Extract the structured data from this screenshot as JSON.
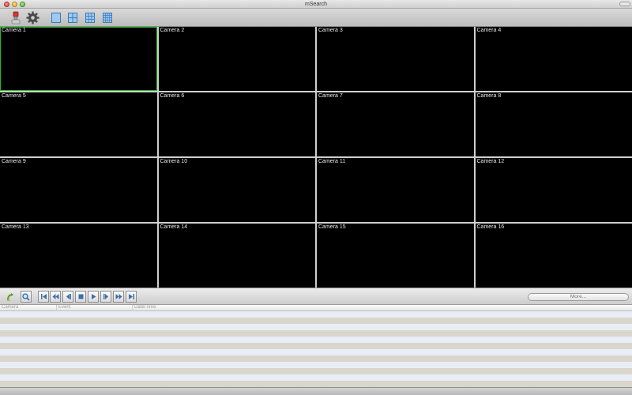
{
  "window": {
    "title": "mSearch"
  },
  "toolbar": {
    "buttons": [
      {
        "icon": "camera-connect-icon"
      },
      {
        "icon": "gear-icon"
      },
      {
        "icon": "layout-1x1-icon"
      },
      {
        "icon": "layout-2x2-icon"
      },
      {
        "icon": "layout-3x3-icon"
      },
      {
        "icon": "layout-4x4-icon"
      }
    ]
  },
  "cameras": [
    {
      "label": "Camera 1",
      "selected": true
    },
    {
      "label": "Camera 2"
    },
    {
      "label": "Camera 3"
    },
    {
      "label": "Camera 4"
    },
    {
      "label": "Camera 5"
    },
    {
      "label": "Camera 6"
    },
    {
      "label": "Camera 7"
    },
    {
      "label": "Camera 8"
    },
    {
      "label": "Camera 9"
    },
    {
      "label": "Camera 10"
    },
    {
      "label": "Camera 11"
    },
    {
      "label": "Camera 12"
    },
    {
      "label": "Camera 13"
    },
    {
      "label": "Camera 14"
    },
    {
      "label": "Camera 15"
    },
    {
      "label": "Camera 16"
    }
  ],
  "playback": {
    "buttons": [
      {
        "icon": "refresh-icon"
      },
      {
        "icon": "search-icon"
      },
      {
        "icon": "skip-to-start-icon"
      },
      {
        "icon": "rewind-icon"
      },
      {
        "icon": "step-back-icon"
      },
      {
        "icon": "stop-icon"
      },
      {
        "icon": "play-icon"
      },
      {
        "icon": "step-forward-icon"
      },
      {
        "icon": "fast-forward-icon"
      },
      {
        "icon": "skip-to-end-icon"
      }
    ],
    "more_label": "More..."
  },
  "event_list": {
    "columns": [
      "Camera",
      "Event",
      "Date/Time"
    ],
    "rows": []
  },
  "colors": {
    "selected_camera_border": "#1fbf1f",
    "camera_background": "#000000"
  }
}
